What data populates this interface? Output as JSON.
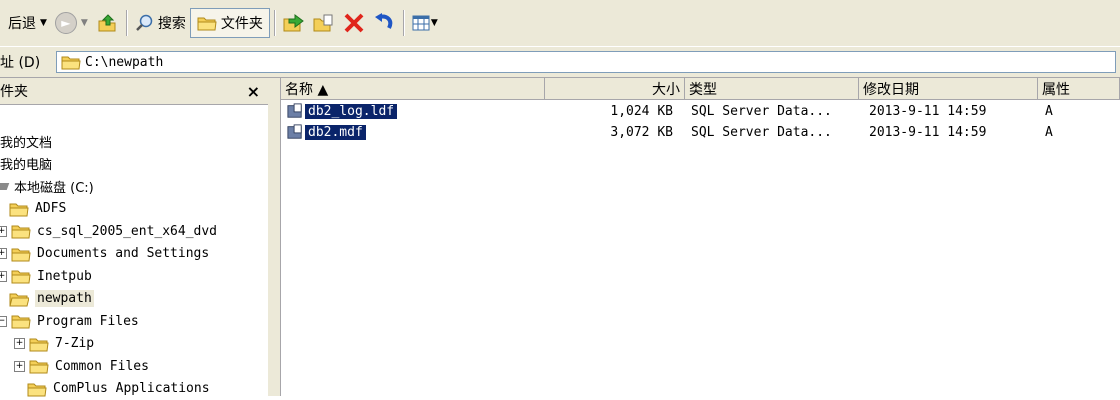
{
  "toolbar": {
    "back_label": "后退",
    "search_label": "搜索",
    "folders_label": "文件夹"
  },
  "address": {
    "label": "址 (D)",
    "value": "C:\\newpath"
  },
  "folder_pane": {
    "title": "件夹",
    "close": "×",
    "tree": [
      {
        "label": "我的文档",
        "indent": 0,
        "expander": "",
        "folder": false
      },
      {
        "label": "我的电脑",
        "indent": 0,
        "expander": "",
        "folder": false
      },
      {
        "label": "本地磁盘 (C:)",
        "indent": 0,
        "expander": "",
        "folder": false
      },
      {
        "label": "ADFS",
        "indent": 1,
        "expander": "",
        "folder": true
      },
      {
        "label": "cs_sql_2005_ent_x64_dvd",
        "indent": 1,
        "expander": "+",
        "folder": true
      },
      {
        "label": "Documents and Settings",
        "indent": 1,
        "expander": "+",
        "folder": true
      },
      {
        "label": "Inetpub",
        "indent": 1,
        "expander": "+",
        "folder": true
      },
      {
        "label": "newpath",
        "indent": 1,
        "expander": "",
        "folder": true,
        "selected": true
      },
      {
        "label": "Program Files",
        "indent": 1,
        "expander": "−",
        "folder": true
      },
      {
        "label": "7-Zip",
        "indent": 2,
        "expander": "+",
        "folder": true
      },
      {
        "label": "Common Files",
        "indent": 2,
        "expander": "+",
        "folder": true
      },
      {
        "label": "ComPlus Applications",
        "indent": 2,
        "expander": "",
        "folder": true
      }
    ]
  },
  "file_list": {
    "columns": [
      "名称 ▲",
      "大小",
      "类型",
      "修改日期",
      "属性"
    ],
    "rows": [
      {
        "name": "db2_log.ldf",
        "size": "1,024 KB",
        "type": "SQL Server Data...",
        "modified": "2013-9-11 14:59",
        "attr": "A"
      },
      {
        "name": "db2.mdf",
        "size": "3,072 KB",
        "type": "SQL Server Data...",
        "modified": "2013-9-11 14:59",
        "attr": "A"
      }
    ]
  }
}
